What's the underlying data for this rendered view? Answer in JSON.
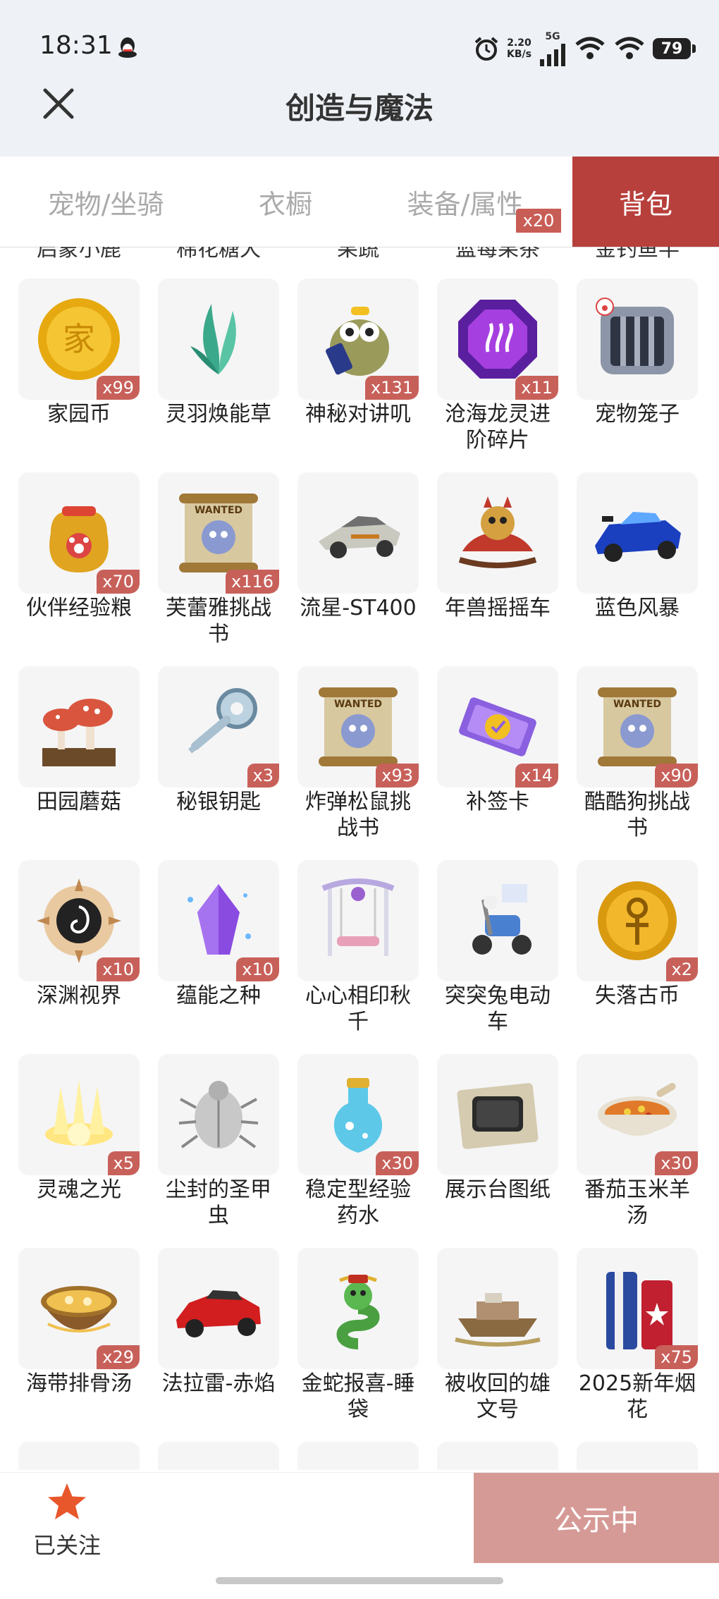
{
  "status": {
    "time": "18:31",
    "net_speed_value": "2.20",
    "net_speed_unit": "KB/s",
    "network": "5G",
    "battery": "79"
  },
  "header": {
    "title": "创造与魔法"
  },
  "tabs": [
    {
      "label": "宠物/坐骑"
    },
    {
      "label": "衣橱"
    },
    {
      "label": "装备/属性",
      "badge": "x20"
    },
    {
      "label": "背包",
      "active": true
    }
  ],
  "cut_off_row": [
    "启蒙小鹿",
    "棉花糖犬",
    "果蔬",
    "蓝莓果茶",
    "金钓鱼竿"
  ],
  "items": [
    {
      "name": "家园币",
      "count": "x99",
      "icon": "coin-icon"
    },
    {
      "name": "灵羽焕能草",
      "count": "",
      "icon": "feather-grass-icon"
    },
    {
      "name": "神秘对讲叽",
      "count": "x131",
      "icon": "walkie-talkie-bird-icon"
    },
    {
      "name": "沧海龙灵进阶碎片",
      "count": "x11",
      "icon": "purple-gem-icon"
    },
    {
      "name": "宠物笼子",
      "count": "",
      "icon": "pet-cage-icon"
    },
    {
      "name": "伙伴经验粮",
      "count": "x70",
      "icon": "food-bag-icon"
    },
    {
      "name": "芙蕾雅挑战书",
      "count": "x116",
      "icon": "wanted-scroll-icon"
    },
    {
      "name": "流星-ST400",
      "count": "",
      "icon": "racer-icon"
    },
    {
      "name": "年兽摇摇车",
      "count": "",
      "icon": "rocking-car-icon"
    },
    {
      "name": "蓝色风暴",
      "count": "",
      "icon": "blue-racecar-icon"
    },
    {
      "name": "田园蘑菇",
      "count": "",
      "icon": "mushroom-icon"
    },
    {
      "name": "秘银钥匙",
      "count": "x3",
      "icon": "key-icon"
    },
    {
      "name": "炸弹松鼠挑战书",
      "count": "x93",
      "icon": "wanted-scroll-icon"
    },
    {
      "name": "补签卡",
      "count": "x14",
      "icon": "ticket-icon"
    },
    {
      "name": "酷酷狗挑战书",
      "count": "x90",
      "icon": "wanted-scroll-icon"
    },
    {
      "name": "深渊视界",
      "count": "x10",
      "icon": "abyss-icon"
    },
    {
      "name": "蕴能之种",
      "count": "x10",
      "icon": "crystal-icon"
    },
    {
      "name": "心心相印秋千",
      "count": "",
      "icon": "swing-icon"
    },
    {
      "name": "突突兔电动车",
      "count": "",
      "icon": "scooter-icon"
    },
    {
      "name": "失落古币",
      "count": "x2",
      "icon": "ancient-coin-icon"
    },
    {
      "name": "灵魂之光",
      "count": "x5",
      "icon": "light-icon"
    },
    {
      "name": "尘封的圣甲虫",
      "count": "",
      "icon": "beetle-icon"
    },
    {
      "name": "稳定型经验药水",
      "count": "x30",
      "icon": "potion-icon"
    },
    {
      "name": "展示台图纸",
      "count": "",
      "icon": "blueprint-icon"
    },
    {
      "name": "番茄玉米羊汤",
      "count": "x30",
      "icon": "soup-bowl-icon"
    },
    {
      "name": "海带排骨汤",
      "count": "x29",
      "icon": "stew-pot-icon"
    },
    {
      "name": "法拉雷-赤焰",
      "count": "",
      "icon": "red-car-icon"
    },
    {
      "name": "金蛇报喜-睡袋",
      "count": "",
      "icon": "snake-icon"
    },
    {
      "name": "被收回的雄文号",
      "count": "",
      "icon": "ship-icon"
    },
    {
      "name": "2025新年烟花",
      "count": "x75",
      "icon": "firework-icon"
    }
  ],
  "bottom": {
    "follow_label": "已关注",
    "announce_label": "公示中"
  },
  "colors": {
    "accent": "#b8403c",
    "badge": "#c8605a",
    "announce": "#d69a96"
  }
}
